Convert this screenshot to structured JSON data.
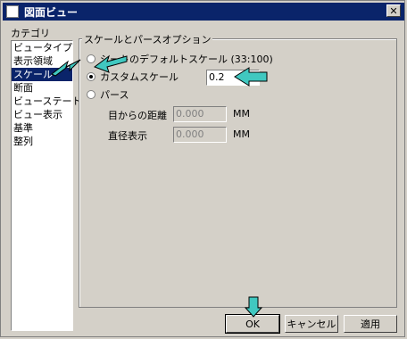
{
  "window": {
    "title": "図面ビュー",
    "close_glyph": "✕"
  },
  "category": {
    "label": "カテゴリ",
    "items": [
      "ビュータイプ",
      "表示領域",
      "スケール",
      "断面",
      "ビューステート",
      "ビュー表示",
      "基準",
      "整列"
    ],
    "selected_index": 2
  },
  "group": {
    "label": "スケールとパースオプション",
    "radio_sheet": "シートのデフォルトスケール (33:100)",
    "radio_custom": "カスタムスケール",
    "custom_value": "0.2",
    "radio_perspective": "パース",
    "distance_label": "目からの距離",
    "distance_value": "0.000",
    "distance_unit": "MM",
    "diameter_label": "直径表示",
    "diameter_value": "0.000",
    "diameter_unit": "MM"
  },
  "buttons": {
    "ok": "OK",
    "cancel": "キャンセル",
    "apply": "適用"
  },
  "colors": {
    "annotation_arrow": "#40c8c0",
    "selection": "#0a246a"
  }
}
